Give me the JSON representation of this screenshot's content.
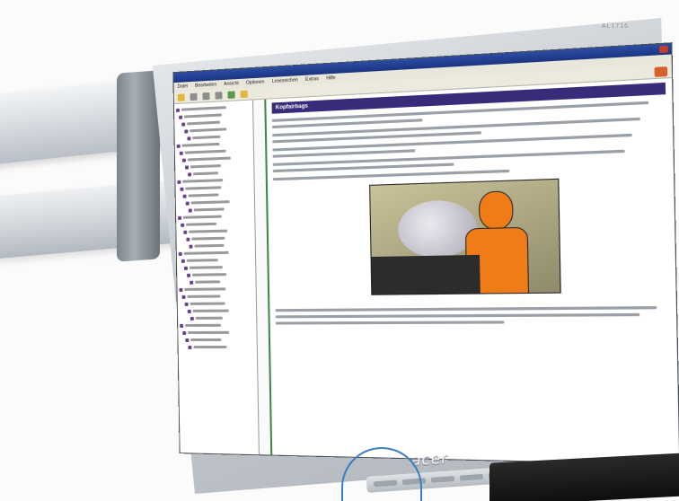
{
  "scene": {
    "title": "Monitor on wall-mounted swing arm displaying a help application"
  },
  "monitor": {
    "brand": "acer",
    "model": "AL1716"
  },
  "app": {
    "header": "Kopfairbags",
    "menu_items": [
      "Datei",
      "Bearbeiten",
      "Ansicht",
      "Optionen",
      "Lesezeichen",
      "Extras",
      "Hilfe"
    ]
  }
}
